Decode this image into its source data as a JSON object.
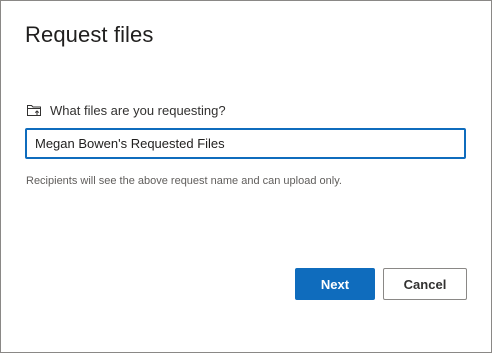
{
  "dialog": {
    "title": "Request files",
    "question_label": "What files are you requesting?",
    "input_value": "Megan Bowen's Requested Files",
    "hint": "Recipients will see the above request name and can upload only.",
    "next_label": "Next",
    "cancel_label": "Cancel",
    "icon": "folder-upload-icon"
  },
  "colors": {
    "accent": "#0f6cbd",
    "text": "#323130",
    "hint": "#605e5c"
  }
}
